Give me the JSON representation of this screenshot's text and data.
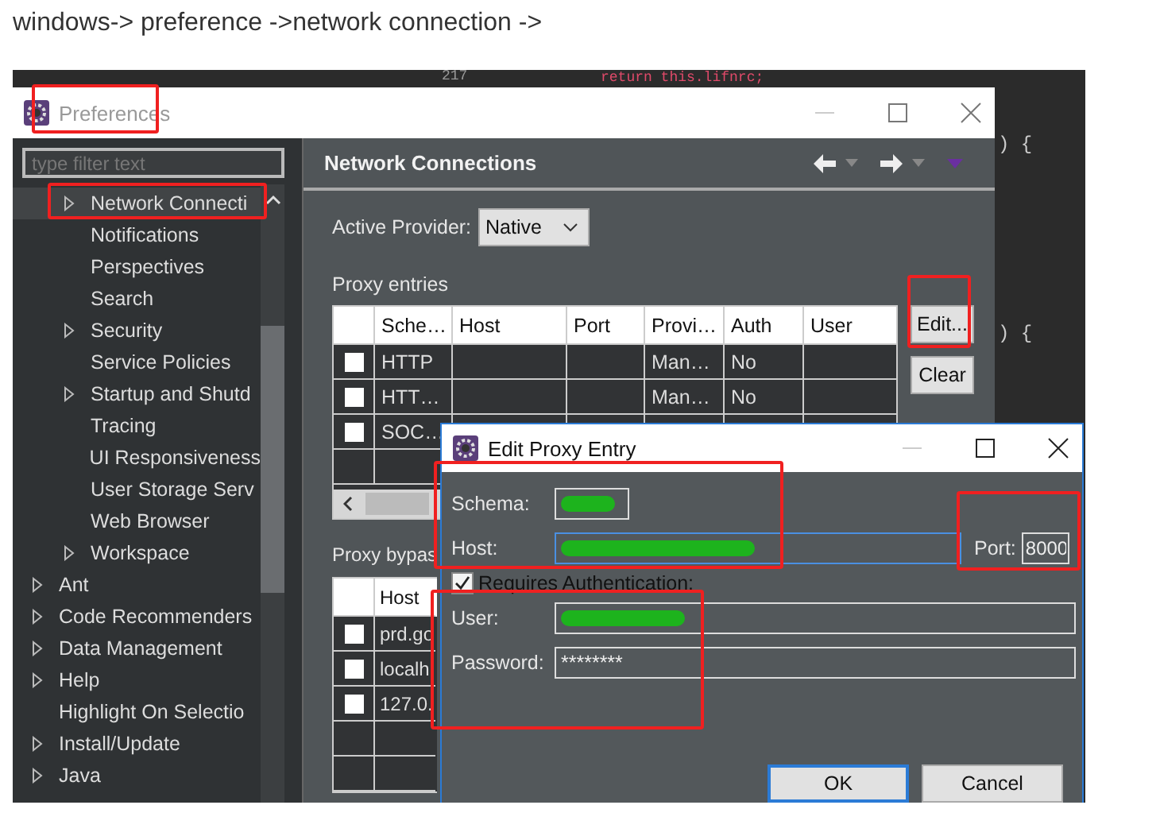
{
  "caption": "windows-> preference ->network connection ->",
  "editor": {
    "line_number": "217",
    "code": "return this.lifnrc;",
    "code_fragments": [
      ") {",
      ") {"
    ]
  },
  "preferences": {
    "title": "Preferences",
    "filter": {
      "placeholder": "type filter text"
    },
    "tree": {
      "nested_items": [
        {
          "label": "Network Connecti",
          "expandable": true,
          "selected": true
        },
        {
          "label": "Notifications",
          "expandable": false,
          "selected": false
        },
        {
          "label": "Perspectives",
          "expandable": false,
          "selected": false
        },
        {
          "label": "Search",
          "expandable": false,
          "selected": false
        },
        {
          "label": "Security",
          "expandable": true,
          "selected": false
        },
        {
          "label": "Service Policies",
          "expandable": false,
          "selected": false
        },
        {
          "label": "Startup and Shutd",
          "expandable": true,
          "selected": false
        },
        {
          "label": "Tracing",
          "expandable": false,
          "selected": false
        },
        {
          "label": "UI Responsiveness",
          "expandable": false,
          "selected": false
        },
        {
          "label": "User Storage Serv",
          "expandable": false,
          "selected": false
        },
        {
          "label": "Web Browser",
          "expandable": false,
          "selected": false
        },
        {
          "label": "Workspace",
          "expandable": true,
          "selected": false
        }
      ],
      "items": [
        {
          "label": "Ant",
          "expandable": true,
          "selected": false
        },
        {
          "label": "Code Recommenders",
          "expandable": true,
          "selected": false
        },
        {
          "label": "Data Management",
          "expandable": true,
          "selected": false
        },
        {
          "label": "Help",
          "expandable": true,
          "selected": false
        },
        {
          "label": "Highlight On Selectio",
          "expandable": false,
          "selected": false
        },
        {
          "label": "Install/Update",
          "expandable": true,
          "selected": false
        },
        {
          "label": "Java",
          "expandable": true,
          "selected": false
        }
      ]
    },
    "page": {
      "title": "Network Connections",
      "active_provider": {
        "label": "Active Provider:",
        "value": "Native"
      },
      "proxy_entries": {
        "label": "Proxy entries",
        "columns": [
          "Sche…",
          "Host",
          "Port",
          "Provi…",
          "Auth",
          "User"
        ],
        "rows": [
          {
            "checked": false,
            "scheme": "HTTP",
            "provider": "Man…",
            "auth": "No"
          },
          {
            "checked": false,
            "scheme": "HTT…",
            "provider": "Man…",
            "auth": "No"
          },
          {
            "checked": false,
            "scheme": "SOC…"
          }
        ]
      },
      "buttons": [
        "Edit...",
        "Clear"
      ],
      "proxy_bypass": {
        "label": "Proxy bypas",
        "columns": [
          "Host"
        ],
        "rows": [
          {
            "checked": false,
            "host": "prd.go"
          },
          {
            "checked": false,
            "host": "localh"
          },
          {
            "checked": false,
            "host": "127.0."
          }
        ]
      }
    }
  },
  "dialog": {
    "title": "Edit Proxy Entry",
    "schema": {
      "label": "Schema:"
    },
    "host": {
      "label": "Host:"
    },
    "port": {
      "label": "Port:",
      "value": "8000"
    },
    "auth": {
      "label": "Requires Authentication:",
      "checked": true
    },
    "user": {
      "label": "User:"
    },
    "password": {
      "label": "Password:",
      "value": "********"
    },
    "buttons": [
      {
        "label": "OK",
        "default": true
      },
      {
        "label": "Cancel",
        "default": false
      }
    ]
  }
}
